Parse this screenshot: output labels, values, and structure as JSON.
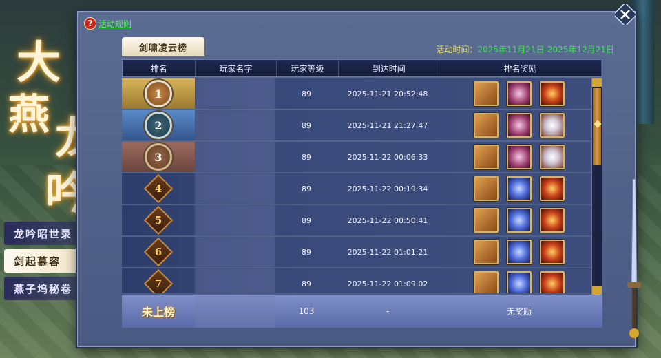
{
  "title_art": {
    "chars": [
      "大",
      "燕",
      "龙",
      "吟"
    ]
  },
  "side_menu": {
    "items": [
      {
        "label": "龙吟昭世录",
        "active": false
      },
      {
        "label": "剑起慕容",
        "active": true
      },
      {
        "label": "燕子坞秘卷",
        "active": false
      }
    ]
  },
  "panel": {
    "rules_link": "活动规则",
    "tab_label": "剑啸凌云榜",
    "activity_time_label": "活动时间：",
    "activity_time_value": "2025年11月21日-2025年12月21日"
  },
  "table": {
    "headers": [
      "排名",
      "玩家名字",
      "玩家等级",
      "到达时间",
      "排名奖励"
    ],
    "rows": [
      {
        "rank": "1",
        "level": "89",
        "time": "2025-11-21  20:52:48",
        "rewards": [
          "scroll-icon",
          "pink-orb-icon",
          "red-orb-icon"
        ]
      },
      {
        "rank": "2",
        "level": "89",
        "time": "2025-11-21  21:27:47",
        "rewards": [
          "scroll-icon",
          "pink-orb-icon",
          "white-beast-icon"
        ]
      },
      {
        "rank": "3",
        "level": "89",
        "time": "2025-11-22  00:06:33",
        "rewards": [
          "scroll-icon",
          "pink-orb-icon",
          "white-beast-icon"
        ]
      },
      {
        "rank": "4",
        "level": "89",
        "time": "2025-11-22  00:19:34",
        "rewards": [
          "scroll-icon",
          "blue-crystal-icon",
          "red-orb-icon"
        ]
      },
      {
        "rank": "5",
        "level": "89",
        "time": "2025-11-22  00:50:41",
        "rewards": [
          "scroll-icon",
          "blue-crystal-icon",
          "red-orb-icon"
        ]
      },
      {
        "rank": "6",
        "level": "89",
        "time": "2025-11-22  01:01:21",
        "rewards": [
          "scroll-icon",
          "blue-crystal-icon",
          "red-orb-icon"
        ]
      },
      {
        "rank": "7",
        "level": "89",
        "time": "2025-11-22  01:09:02",
        "rewards": [
          "scroll-icon",
          "blue-crystal-icon",
          "red-orb-icon"
        ]
      }
    ],
    "self_row": {
      "rank_label": "未上榜",
      "level": "103",
      "time": "-",
      "reward": "无奖励"
    }
  },
  "colors": {
    "accent_green": "#38e84a",
    "accent_yellow": "#f0e060",
    "gold": "#d8b45a"
  }
}
